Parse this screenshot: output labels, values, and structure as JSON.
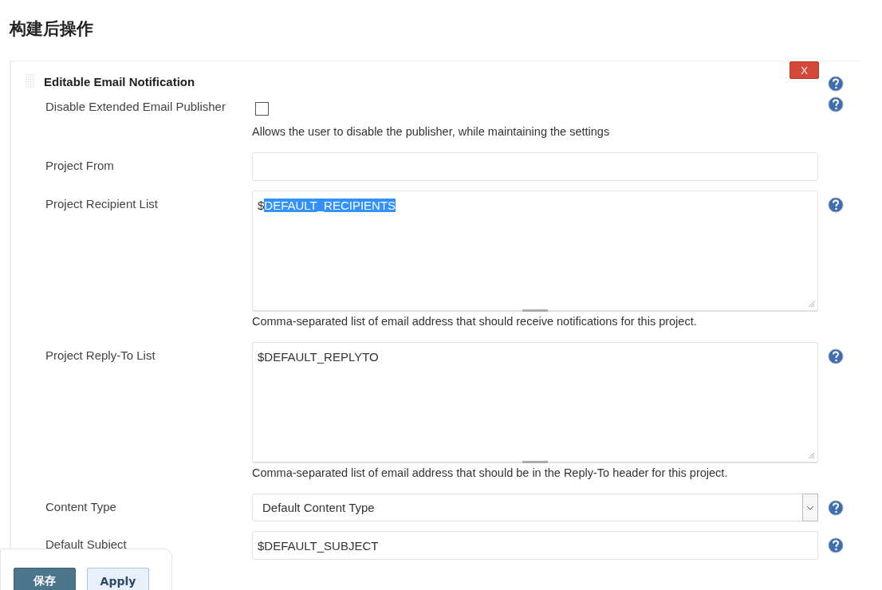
{
  "section_title": "构建后操作",
  "panel": {
    "title": "Editable Email Notification",
    "close_label": "X",
    "help": true
  },
  "rows": [
    {
      "kind": "checkbox",
      "label": "Disable Extended Email Publisher",
      "checked": false,
      "help": true,
      "description": "Allows the user to disable the publisher, while maintaining the settings"
    },
    {
      "kind": "text",
      "label": "Project From",
      "value": "",
      "help": false
    },
    {
      "kind": "textarea",
      "label": "Project Recipient List",
      "parts": [
        {
          "text": "$",
          "selected": false
        },
        {
          "text": "DEFAULT_RECIPIENTS",
          "selected": true
        }
      ],
      "help": true,
      "description": "Comma-separated list of email address that should receive notifications for this project."
    },
    {
      "kind": "textarea",
      "label": "Project Reply-To List",
      "parts": [
        {
          "text": "$DEFAULT_REPLYTO",
          "selected": false
        }
      ],
      "help": true,
      "description": "Comma-separated list of email address that should be in the Reply-To header for this project."
    },
    {
      "kind": "select",
      "label": "Content Type",
      "value": "Default Content Type",
      "help": true
    },
    {
      "kind": "text",
      "label": "Default Subject",
      "value": "$DEFAULT_SUBJECT",
      "help": true
    }
  ],
  "bottom_bar": {
    "buttons": [
      {
        "label": "保存",
        "kind": "primary"
      },
      {
        "label": "Apply",
        "kind": "secondary"
      }
    ]
  }
}
